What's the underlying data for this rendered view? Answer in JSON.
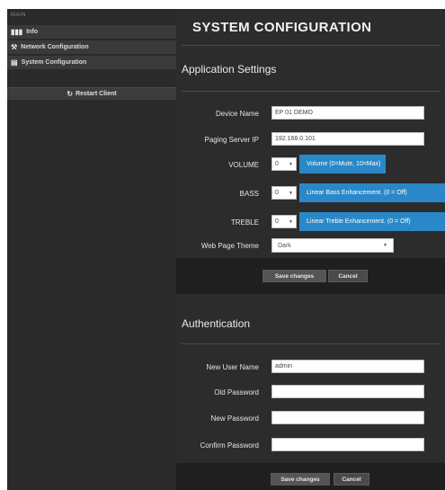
{
  "sidebar": {
    "heading": "MAIN",
    "items": [
      {
        "icon": "bar-chart-icon",
        "glyph": "▮▮▮",
        "label": "Info"
      },
      {
        "icon": "wrench-icon",
        "glyph": "🔧",
        "label": "Network Configuration"
      },
      {
        "icon": "list-icon",
        "glyph": "▤",
        "label": "System Configuration"
      }
    ],
    "restart_label": "Restart Client",
    "restart_icon": "refresh-icon"
  },
  "main": {
    "title": "SYSTEM CONFIGURATION",
    "application": {
      "title": "Application Settings",
      "device_name_label": "Device Name",
      "device_name_value": "EP 01 DEMO",
      "paging_ip_label": "Paging Server IP",
      "paging_ip_value": "192.168.0.101",
      "volume_label": "VOLUME",
      "volume_value": "0",
      "volume_hint": "Volume (0=Mute, 10=Max)",
      "bass_label": "BASS",
      "bass_value": "0",
      "bass_hint": "Linear Bass Enhancement. (0 = Off)",
      "treble_label": "TREBLE",
      "treble_value": "0",
      "treble_hint": "Linear Treble Enhancement. (0 = Off)",
      "theme_label": "Web Page Theme",
      "theme_value": "Dark",
      "save_label": "Save changes",
      "cancel_label": "Cancel"
    },
    "authentication": {
      "title": "Authentication",
      "new_user_label": "New User Name",
      "new_user_value": "admin",
      "old_password_label": "Old Password",
      "new_password_label": "New Password",
      "confirm_password_label": "Confirm Password",
      "save_label": "Save changes",
      "cancel_label": "Cancel"
    }
  },
  "colors": {
    "sidebar_bg": "#2a2a2a",
    "main_bg": "#2c2c2c",
    "hint_blue": "#2a88c8",
    "footer_bg": "#1f1f1f"
  }
}
